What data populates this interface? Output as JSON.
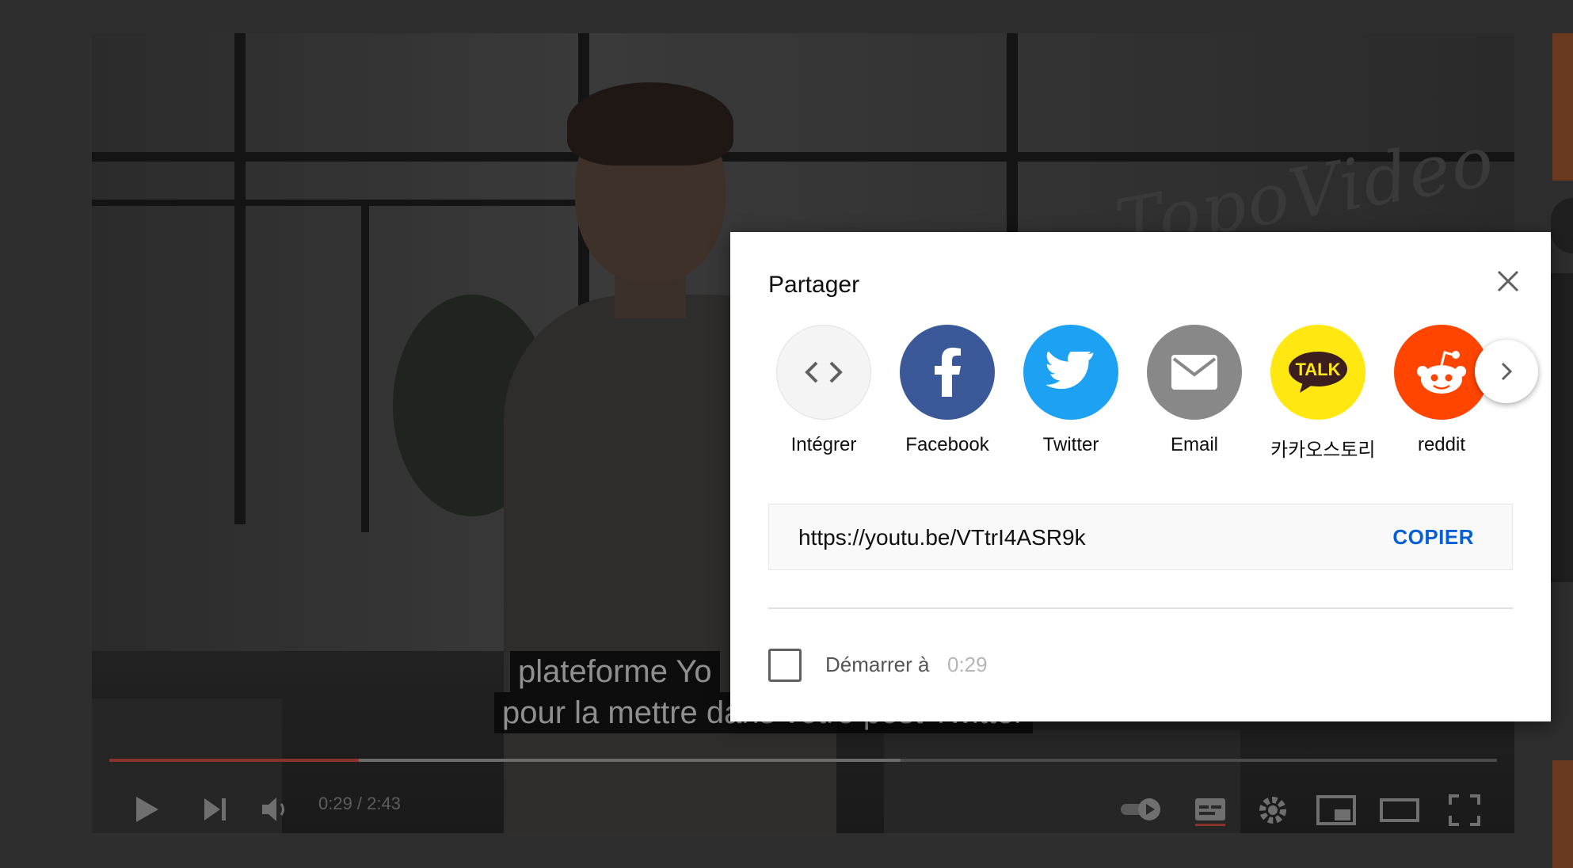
{
  "player": {
    "subtitle_line1": " plateforme Yo",
    "subtitle_line2": "pour la mettre dans votre post Twitter",
    "watermark": "TopoVideo",
    "time": "0:29 / 2:43"
  },
  "dialog": {
    "title": "Partager",
    "share_options": [
      {
        "label": "Intégrer",
        "icon": "embed-code-icon",
        "color": "#f4f4f4"
      },
      {
        "label": "Facebook",
        "icon": "facebook-icon",
        "color": "#3b5998"
      },
      {
        "label": "Twitter",
        "icon": "twitter-bird-icon",
        "color": "#1da1f2"
      },
      {
        "label": "Email",
        "icon": "envelope-icon",
        "color": "#888888"
      },
      {
        "label": "카카오스토리",
        "icon": "kakaotalk-icon",
        "icon_text": "TALK",
        "color": "#ffe812"
      },
      {
        "label": "reddit",
        "icon": "reddit-alien-icon",
        "color": "#ff4500"
      }
    ],
    "url": "https://youtu.be/VTtrI4ASR9k",
    "copy_label": "COPIER",
    "start_at_label": "Démarrer à",
    "start_at_time": "0:29",
    "accent_color": "#065fd4"
  }
}
